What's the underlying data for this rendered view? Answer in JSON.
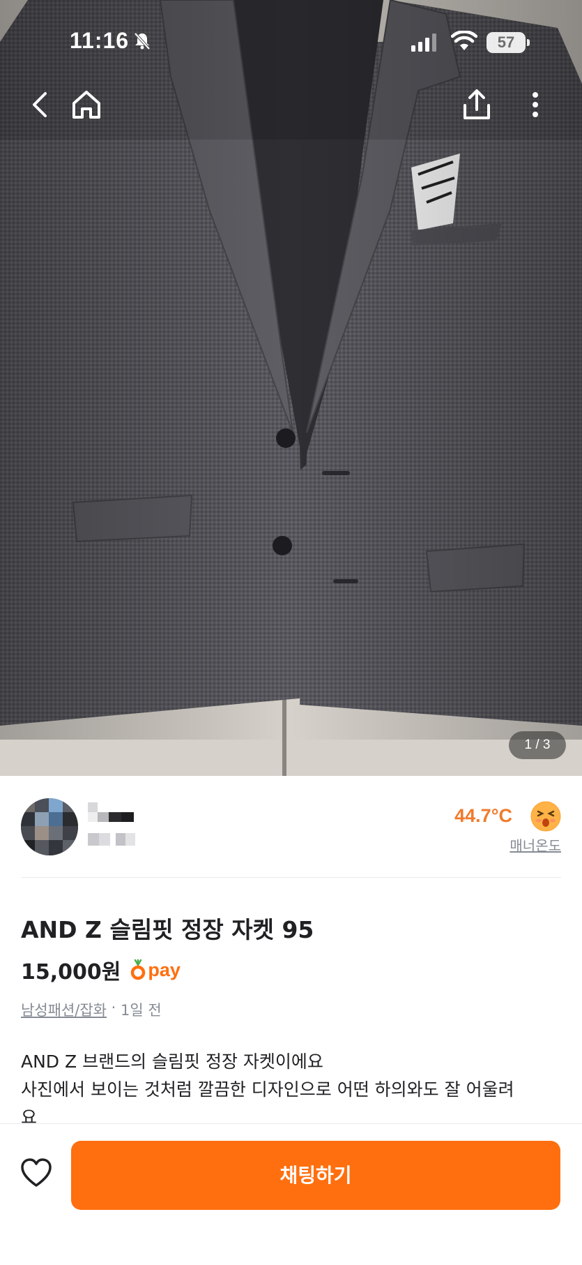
{
  "status_bar": {
    "time": "11:16",
    "battery": "57",
    "icons": [
      "bell-slash-icon",
      "cellular-signal-icon",
      "wifi-icon",
      "battery-icon"
    ]
  },
  "nav": {
    "icons": [
      "back-arrow-icon",
      "home-icon",
      "share-icon",
      "more-vertical-icon"
    ]
  },
  "gallery": {
    "current_index": 1,
    "total": 3,
    "indicator": "1 / 3"
  },
  "seller": {
    "temperature": "44.7°C",
    "temperature_label": "매너온도",
    "temperature_color": "#f07b2c"
  },
  "listing": {
    "title": "AND Z 슬림핏 정장 자켓 95",
    "price": "15,000원",
    "pay_label": "pay",
    "category": "남성패션/잡화",
    "separator": " · ",
    "time_ago": "1일 전",
    "description": [
      "AND Z 브랜드의 슬림핏 정장 자켓이에요",
      "사진에서 보이는 것처럼 깔끔한 디자인으로 어떤 하의와도 잘 어울려",
      "요"
    ]
  },
  "bottom_bar": {
    "chat_button": "채팅하기",
    "brand_color": "#ff6f0f"
  }
}
